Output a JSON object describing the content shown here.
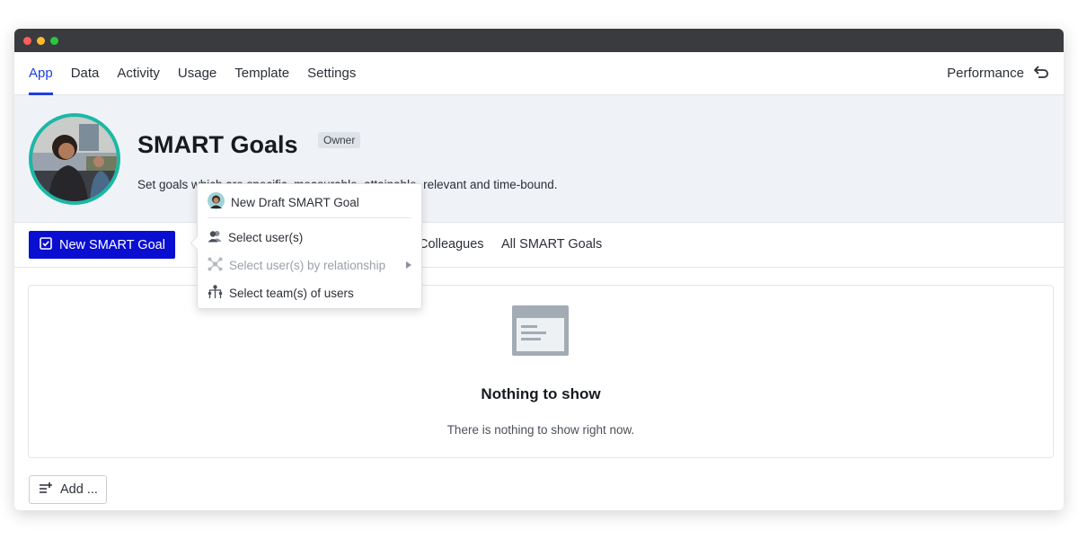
{
  "window": {
    "dots": [
      "#ff5f57",
      "#febc2e",
      "#28c840"
    ]
  },
  "topnav": {
    "tabs": [
      {
        "label": "App",
        "active": true
      },
      {
        "label": "Data"
      },
      {
        "label": "Activity"
      },
      {
        "label": "Usage"
      },
      {
        "label": "Template"
      },
      {
        "label": "Settings"
      }
    ],
    "right_label": "Performance",
    "right_icon": "return-arrow-icon"
  },
  "hero": {
    "title": "SMART Goals",
    "badge": "Owner",
    "description": "Set goals which are specific, measurable, attainable, relevant and time-bound."
  },
  "subbar": {
    "primary_button": "New SMART Goal",
    "tabs": [
      "Colleagues",
      "All SMART Goals"
    ]
  },
  "dropdown": {
    "items": [
      {
        "label": "New Draft SMART Goal",
        "icon": "user-avatar-icon"
      },
      {
        "label": "Select user(s)",
        "icon": "users-icon"
      },
      {
        "label": "Select user(s) by relationship",
        "icon": "relationship-icon",
        "disabled": true,
        "submenu": true
      },
      {
        "label": "Select team(s) of users",
        "icon": "team-hierarchy-icon"
      }
    ]
  },
  "empty_state": {
    "icon": "document-window-icon",
    "title": "Nothing to show",
    "description": "There is nothing to show right now."
  },
  "add_button": {
    "label": "Add ..."
  },
  "colors": {
    "accent": "#1f3ee0",
    "primary_button": "#0a0ed0",
    "hero_bg": "#eff3f7",
    "avatar_ring": "#1bb8a6"
  }
}
